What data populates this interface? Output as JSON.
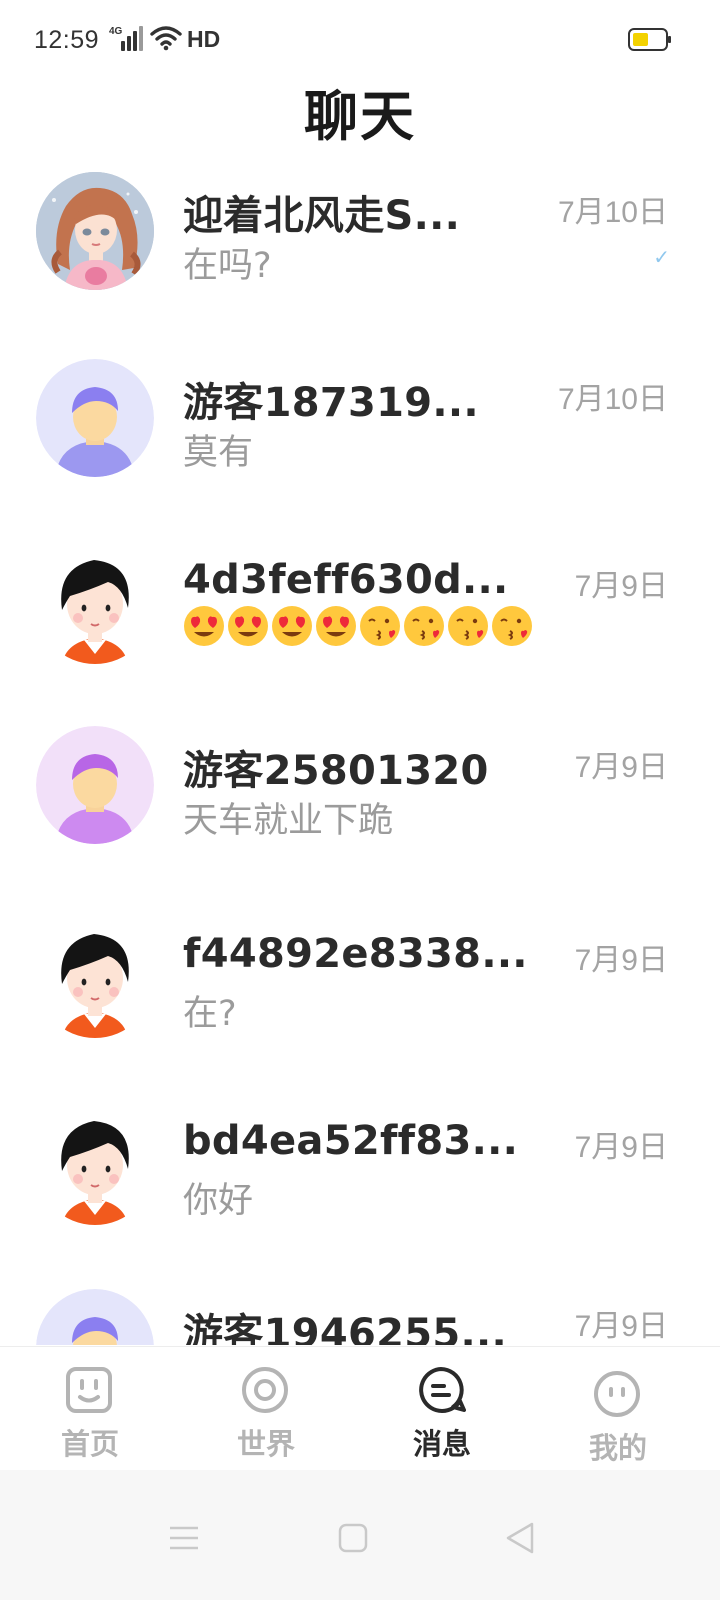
{
  "status_bar": {
    "time": "12:59",
    "network": "4G",
    "hd": "HD"
  },
  "title": "聊天",
  "chats": [
    {
      "name": "迎着北风走S...",
      "message": "在吗?",
      "date": "7月10日",
      "read": true
    },
    {
      "name": "游客187319...",
      "message": "莫有",
      "date": "7月10日"
    },
    {
      "name": "4d3feff630d...",
      "message": "",
      "date": "7月9日",
      "emojis": [
        "heart-eyes",
        "heart-eyes",
        "heart-eyes",
        "heart-eyes",
        "kiss",
        "kiss",
        "kiss",
        "kiss"
      ]
    },
    {
      "name": "游客25801320",
      "message": "天车就业下跪",
      "date": "7月9日"
    },
    {
      "name": "f44892e8338...",
      "message": "在?",
      "date": "7月9日"
    },
    {
      "name": "bd4ea52ff83...",
      "message": "你好",
      "date": "7月9日"
    },
    {
      "name": "游客1946255...",
      "message": "",
      "date": "7月9日"
    }
  ],
  "nav": {
    "home": "首页",
    "world": "世界",
    "messages": "消息",
    "mine": "我的",
    "active": "messages"
  },
  "colors": {
    "active_label": "#2a2a2a",
    "inactive_label": "#b4b4b4",
    "date": "#a3a3a3",
    "read_check": "#90c8ee",
    "battery": "#f3d200"
  }
}
